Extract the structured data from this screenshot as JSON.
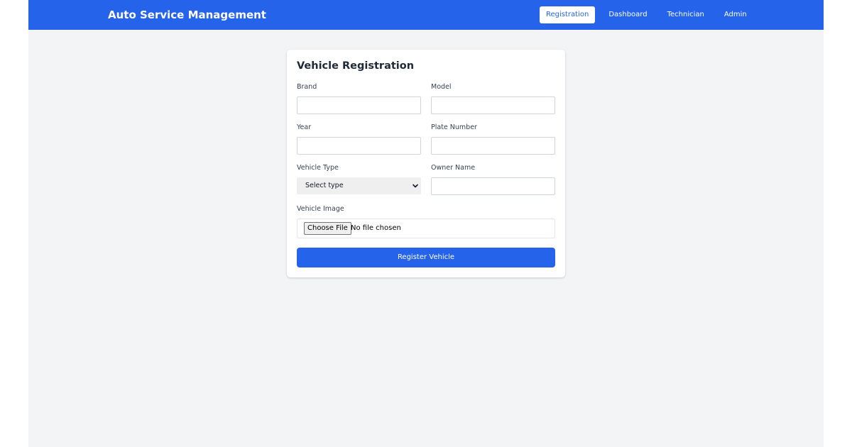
{
  "header": {
    "brand": "Auto Service Management",
    "nav": [
      {
        "label": "Registration",
        "active": true
      },
      {
        "label": "Dashboard",
        "active": false
      },
      {
        "label": "Technician",
        "active": false
      },
      {
        "label": "Admin",
        "active": false
      }
    ]
  },
  "form": {
    "title": "Vehicle Registration",
    "fields": {
      "brand": {
        "label": "Brand",
        "value": "",
        "placeholder": ""
      },
      "model": {
        "label": "Model",
        "value": "",
        "placeholder": ""
      },
      "year": {
        "label": "Year",
        "value": "",
        "placeholder": ""
      },
      "plate_number": {
        "label": "Plate Number",
        "value": "",
        "placeholder": ""
      },
      "vehicle_type": {
        "label": "Vehicle Type",
        "selected": "Select type"
      },
      "owner_name": {
        "label": "Owner Name",
        "value": "",
        "placeholder": ""
      },
      "vehicle_image": {
        "label": "Vehicle Image",
        "button_label": "Choose File",
        "status": "No file chosen"
      }
    },
    "submit_label": "Register Vehicle"
  },
  "colors": {
    "primary": "#2563eb",
    "page_background": "#f3f4f6",
    "card_background": "#ffffff",
    "title_text": "#1f2937"
  },
  "icons": {
    "select_chevron": "chevron-down-icon"
  }
}
